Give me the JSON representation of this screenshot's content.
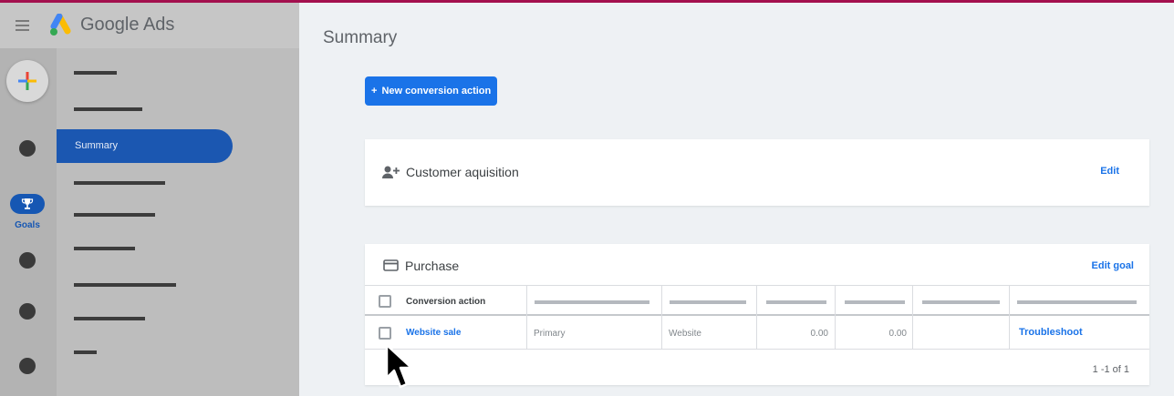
{
  "app": {
    "brand": "Google Ads",
    "colors": {
      "top_accent": "#a3104e",
      "primary_blue": "#1a73e8",
      "nav_active": "#1b57b1"
    }
  },
  "rail": {
    "goals_label": "Goals",
    "icons": [
      "menu-icon",
      "create-plus-icon",
      "trophy-icon"
    ]
  },
  "nav": {
    "active_item": "Summary"
  },
  "main": {
    "title": "Summary",
    "new_button": {
      "plus": "+",
      "label": "New conversion action"
    }
  },
  "goals": [
    {
      "title": "Customer aquisition",
      "icon": "person-add-icon",
      "action": "Edit"
    },
    {
      "title": "Purchase",
      "icon": "credit-card-icon",
      "action": "Edit goal",
      "table": {
        "header": {
          "conversion_action": "Conversion action"
        },
        "rows": [
          {
            "name": "Website sale",
            "optimization": "Primary",
            "source": "Website",
            "value1": "0.00",
            "value2": "0.00",
            "status": "",
            "action": "Troubleshoot"
          }
        ],
        "pagination": "1 -1 of 1"
      }
    }
  ]
}
